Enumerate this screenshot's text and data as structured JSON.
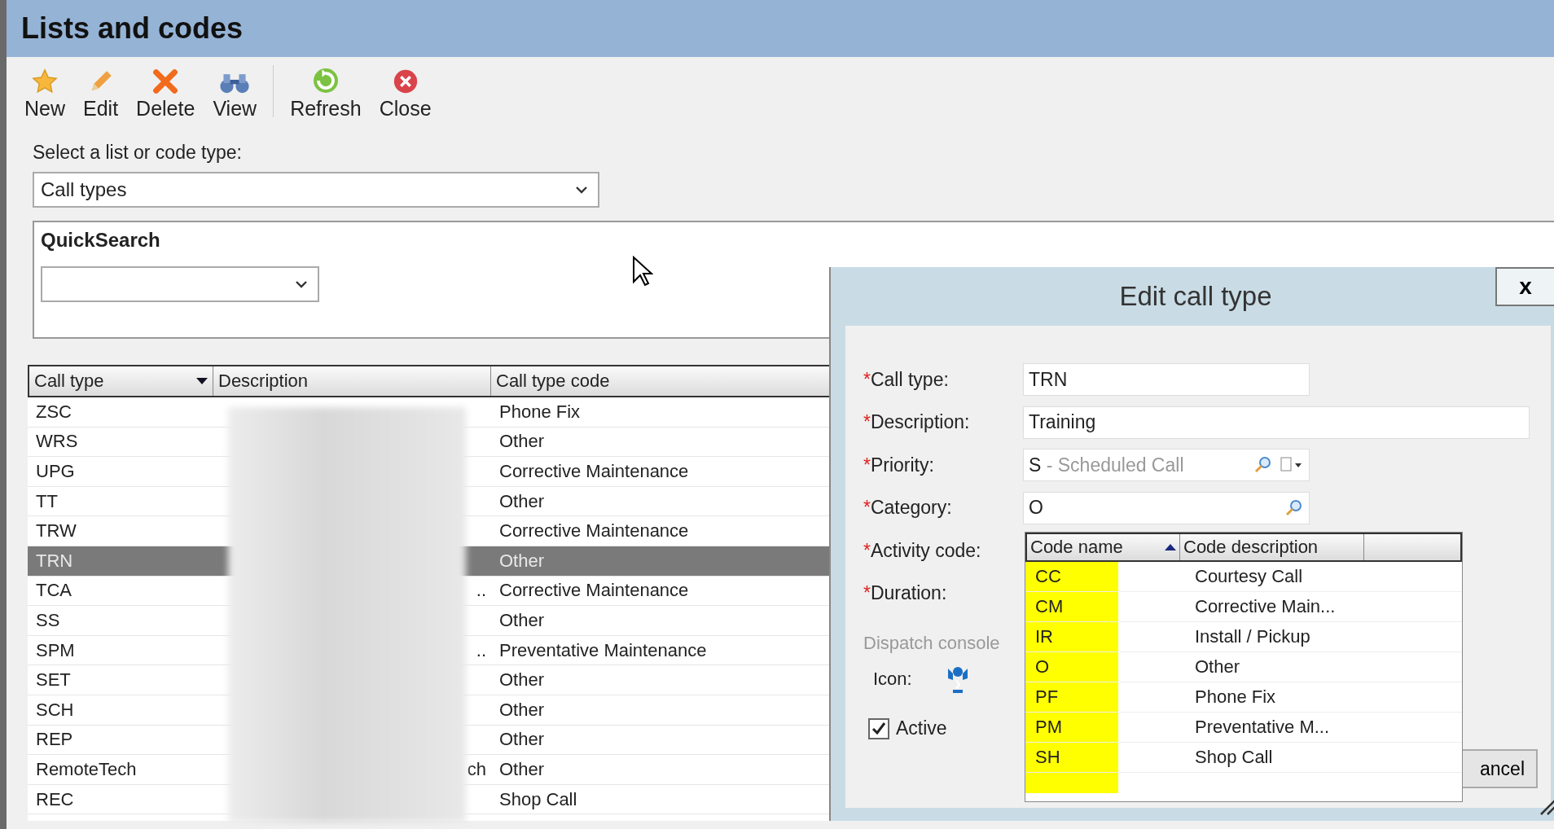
{
  "window": {
    "title": "Lists and codes"
  },
  "toolbar": [
    {
      "label": "New",
      "kind": "new"
    },
    {
      "label": "Edit",
      "kind": "edit"
    },
    {
      "label": "Delete",
      "kind": "delete"
    },
    {
      "label": "View",
      "kind": "view"
    },
    {
      "label": "Refresh",
      "kind": "refresh"
    },
    {
      "label": "Close",
      "kind": "close"
    }
  ],
  "list_selector": {
    "label": "Select a list or code type:",
    "value": "Call types"
  },
  "quick_search": {
    "title": "QuickSearch"
  },
  "table": {
    "columns": [
      {
        "label": "Call type",
        "sorted": true
      },
      {
        "label": "Description",
        "sorted": false
      },
      {
        "label": "Call type code",
        "sorted": false
      }
    ],
    "rows": [
      {
        "call_type": "ZSC",
        "code": "Phone Fix",
        "selected": false
      },
      {
        "call_type": "WRS",
        "code": "Other",
        "selected": false
      },
      {
        "call_type": "UPG",
        "code": "Corrective Maintenance",
        "selected": false
      },
      {
        "call_type": "TT",
        "code": "Other",
        "selected": false
      },
      {
        "call_type": "TRW",
        "code": "Corrective Maintenance",
        "selected": false
      },
      {
        "call_type": "TRN",
        "code": "Other",
        "selected": true
      },
      {
        "call_type": "TCA",
        "description": "..",
        "code": "Corrective Maintenance",
        "selected": false
      },
      {
        "call_type": "SS",
        "code": "Other",
        "selected": false
      },
      {
        "call_type": "SPM",
        "description": "..",
        "code": "Preventative Maintenance",
        "selected": false
      },
      {
        "call_type": "SET",
        "code": "Other",
        "selected": false
      },
      {
        "call_type": "SCH",
        "code": "Other",
        "selected": false
      },
      {
        "call_type": "REP",
        "code": "Other",
        "selected": false
      },
      {
        "call_type": "RemoteTech",
        "description": "ch",
        "code": "Other",
        "selected": false
      },
      {
        "call_type": "REC",
        "code": "Shop Call",
        "selected": false
      }
    ]
  },
  "dialog": {
    "title": "Edit call type",
    "close": "x",
    "required_mark": "*",
    "fields": [
      {
        "label": "Call type:",
        "value": "TRN",
        "kind": "text",
        "required": true
      },
      {
        "label": "Description:",
        "value": "Training",
        "kind": "wide",
        "required": true
      },
      {
        "label": "Priority:",
        "code": "S",
        "value": "- Scheduled Call",
        "kind": "lookup-menu",
        "required": true
      },
      {
        "label": "Category:",
        "value": "O",
        "kind": "lookup",
        "required": true
      }
    ],
    "activity_label": "Activity code:",
    "duration_label": "Duration:",
    "activity_grid": {
      "columns": [
        {
          "label": "Code name",
          "sorted": true
        },
        {
          "label": "Code description",
          "sorted": false
        }
      ],
      "rows": [
        {
          "name": "CC",
          "description": "Courtesy Call"
        },
        {
          "name": "CM",
          "description": "Corrective Main..."
        },
        {
          "name": "IR",
          "description": "Install / Pickup"
        },
        {
          "name": "O",
          "description": "Other"
        },
        {
          "name": "PF",
          "description": "Phone Fix"
        },
        {
          "name": "PM",
          "description": "Preventative M..."
        },
        {
          "name": "SH",
          "description": "Shop Call"
        }
      ]
    },
    "dispatch_section": "Dispatch console",
    "icon_label": "Icon:",
    "active": {
      "label": "Active",
      "checked": true
    },
    "cancel_button": "ancel"
  }
}
